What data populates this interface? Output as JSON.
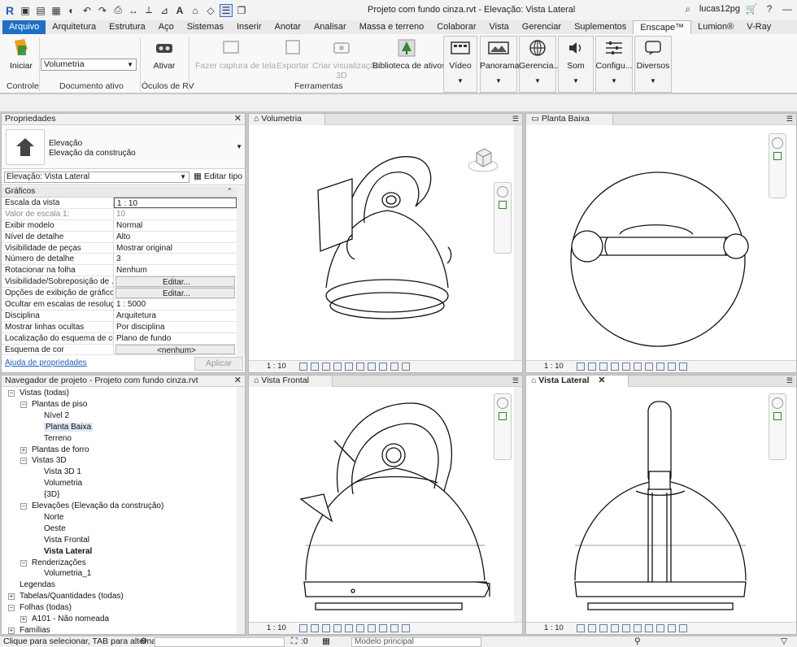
{
  "window": {
    "title": "Projeto com fundo cinza.rvt - Elevação: Vista Lateral",
    "user": "lucas12pg"
  },
  "ribbon_tabs": [
    "Arquivo",
    "Arquitetura",
    "Estrutura",
    "Aço",
    "Sistemas",
    "Inserir",
    "Anotar",
    "Analisar",
    "Massa e terreno",
    "Colaborar",
    "Vista",
    "Gerenciar",
    "Suplementos",
    "Enscape™",
    "Lumion®",
    "V-Ray"
  ],
  "ribbon": {
    "iniciar": "Iniciar",
    "doc_value": "Volumetria",
    "ativar": "Ativar",
    "captura": "Fazer captura de tela",
    "exportar": "Exportar",
    "criar_viz": "Criar visualização",
    "criar_viz2": "3D",
    "biblioteca": "Biblioteca de ativos",
    "video": "Vídeo",
    "panorama": "Panorama",
    "gerencia": "Gerencia...",
    "som": "Som",
    "config": "Configu...",
    "diversos": "Diversos",
    "grp_controle": "Controle",
    "grp_doc": "Documento ativo",
    "grp_oculos": "Óculos de RV",
    "grp_ferr": "Ferramentas"
  },
  "properties": {
    "title": "Propriedades",
    "type_line1": "Elevação",
    "type_line2": "Elevação da construção",
    "selector": "Elevação: Vista Lateral",
    "edit_type": "Editar tipo",
    "section": "Gráficos",
    "rows": [
      {
        "k": "Escala da vista",
        "v": "1 : 10"
      },
      {
        "k": "Valor de escala    1:",
        "v": "10"
      },
      {
        "k": "Exibir modelo",
        "v": "Normal"
      },
      {
        "k": "Nível de detalhe",
        "v": "Alto"
      },
      {
        "k": "Visibilidade de peças",
        "v": "Mostrar original"
      },
      {
        "k": "Número de detalhe",
        "v": "3"
      },
      {
        "k": "Rotacionar na folha",
        "v": "Nenhum"
      },
      {
        "k": "Visibilidade/Sobreposição de ...",
        "v": "Editar..."
      },
      {
        "k": "Opções de exibição de gráficos",
        "v": "Editar..."
      },
      {
        "k": "Ocultar em escalas de resoluç...",
        "v": "1 : 5000"
      },
      {
        "k": "Disciplina",
        "v": "Arquitetura"
      },
      {
        "k": "Mostrar linhas ocultas",
        "v": "Por disciplina"
      },
      {
        "k": "Localização do esquema de cor",
        "v": "Plano de fundo"
      },
      {
        "k": "Esquema de cor",
        "v": "<nenhum>"
      }
    ],
    "help_link": "Ajuda de propriedades",
    "apply": "Aplicar"
  },
  "browser": {
    "title": "Navegador de projeto - Projeto com fundo cinza.rvt",
    "items": [
      "Vistas (todas)",
      "Plantas de piso",
      "Nível 2",
      "Planta Baixa",
      "Terreno",
      "Plantas de forro",
      "Vistas 3D",
      "Vista 3D 1",
      "Volumetria",
      "{3D}",
      "Elevações (Elevação da construção)",
      "Norte",
      "Oeste",
      "Vista Frontal",
      "Vista Lateral",
      "Renderizações",
      "Volumetria_1",
      "Legendas",
      "Tabelas/Quantidades (todas)",
      "Folhas (todas)",
      "A101 - Não nomeada",
      "Famílias"
    ]
  },
  "views": {
    "v1": "Volumetria",
    "v2": "Planta Baixa",
    "v3": "Vista Frontal",
    "v4": "Vista Lateral",
    "scale": "1 : 10"
  },
  "status": {
    "hint": "Clique para selecionar, TAB para alternat",
    "count": ":0",
    "model": "Modelo principal"
  }
}
